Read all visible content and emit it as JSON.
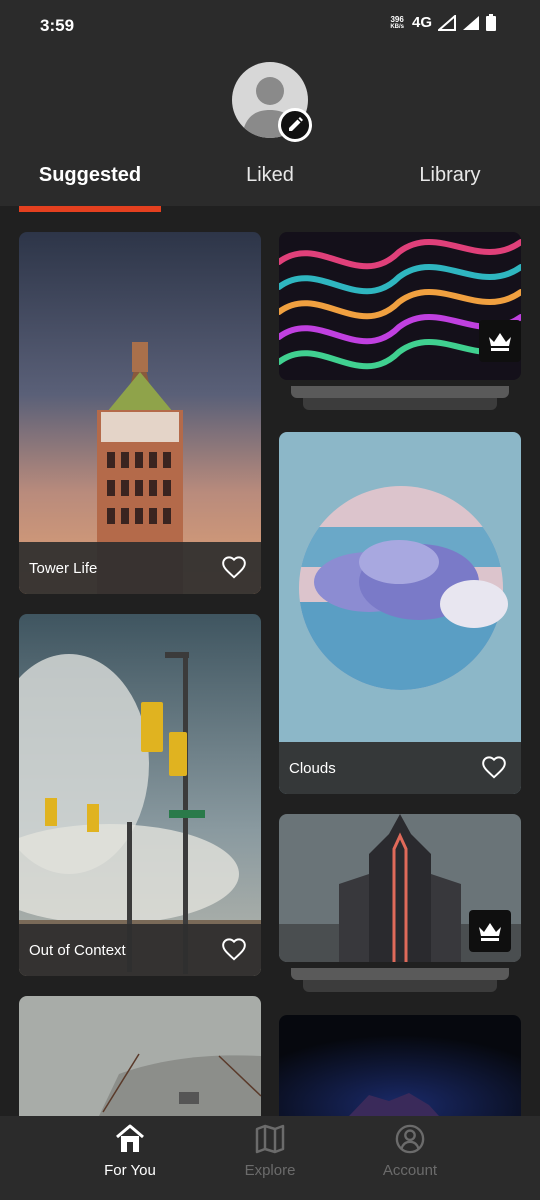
{
  "status_bar": {
    "time": "3:59",
    "net_speed_value": "396",
    "net_speed_unit": "KB/s",
    "network_type": "4G"
  },
  "profile": {
    "avatar_icon": "person-icon",
    "edit_icon": "pencil-icon"
  },
  "tabs": [
    {
      "label": "Suggested",
      "active": true
    },
    {
      "label": "Liked",
      "active": false
    },
    {
      "label": "Library",
      "active": false
    }
  ],
  "colors": {
    "accent": "#e4401f",
    "background": "#202020",
    "surface": "#2b2b2b"
  },
  "wallpapers": {
    "tower_life": {
      "title": "Tower Life",
      "icon": "heart-outline-icon"
    },
    "clouds": {
      "title": "Clouds",
      "icon": "heart-outline-icon"
    },
    "out_of_context": {
      "title": "Out of Context",
      "icon": "heart-outline-icon"
    },
    "abstract_waves": {
      "premium_icon": "crown-icon"
    },
    "dark_castle": {
      "premium_icon": "crown-icon"
    }
  },
  "bottom_nav": [
    {
      "label": "For You",
      "icon": "home-icon",
      "active": true
    },
    {
      "label": "Explore",
      "icon": "map-icon",
      "active": false
    },
    {
      "label": "Account",
      "icon": "account-circle-icon",
      "active": false
    }
  ]
}
